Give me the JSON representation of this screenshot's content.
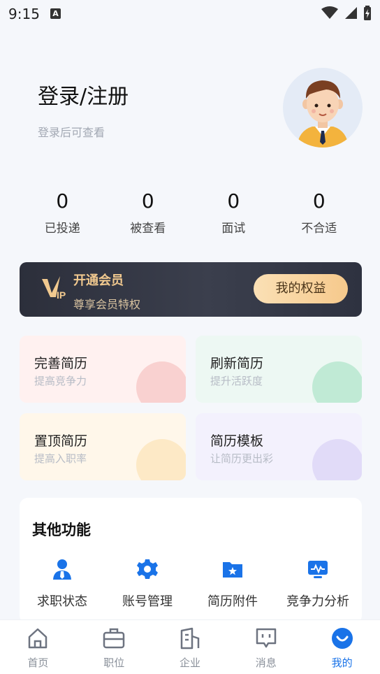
{
  "status_bar": {
    "time": "9:15",
    "a_badge": "A"
  },
  "header": {
    "title": "登录/注册",
    "subtitle": "登录后可查看"
  },
  "stats": [
    {
      "value": "0",
      "label": "已投递"
    },
    {
      "value": "0",
      "label": "被查看"
    },
    {
      "value": "0",
      "label": "面试"
    },
    {
      "value": "0",
      "label": "不合适"
    }
  ],
  "vip": {
    "title": "开通会员",
    "subtitle": "尊享会员特权",
    "button": "我的权益",
    "logo_text": "VIP"
  },
  "cards": [
    {
      "title": "完善简历",
      "subtitle": "提高竞争力",
      "icon": "pencil-icon",
      "color": "#f3b2b0"
    },
    {
      "title": "刷新简历",
      "subtitle": "提升活跃度",
      "icon": "refresh-icon",
      "color": "#93dbb7"
    },
    {
      "title": "置顶简历",
      "subtitle": "提高入职率",
      "icon": "pin-top-icon",
      "color": "#fbdba2"
    },
    {
      "title": "简历模板",
      "subtitle": "让简历更出彩",
      "icon": "template-icon",
      "color": "#cfc5f3"
    }
  ],
  "other_functions": {
    "heading": "其他功能",
    "items": [
      {
        "label": "求职状态",
        "icon": "user-status-icon"
      },
      {
        "label": "账号管理",
        "icon": "gear-icon"
      },
      {
        "label": "简历附件",
        "icon": "folder-star-icon"
      },
      {
        "label": "竞争力分析",
        "icon": "monitor-chart-icon"
      }
    ]
  },
  "tabbar": {
    "items": [
      {
        "label": "首页",
        "icon": "home-icon",
        "active": false
      },
      {
        "label": "职位",
        "icon": "briefcase-icon",
        "active": false
      },
      {
        "label": "企业",
        "icon": "building-icon",
        "active": false
      },
      {
        "label": "消息",
        "icon": "message-icon",
        "active": false
      },
      {
        "label": "我的",
        "icon": "profile-smile-icon",
        "active": true
      }
    ]
  },
  "colors": {
    "accent": "#1a73e8",
    "vip_gold": "#f1c98f"
  }
}
